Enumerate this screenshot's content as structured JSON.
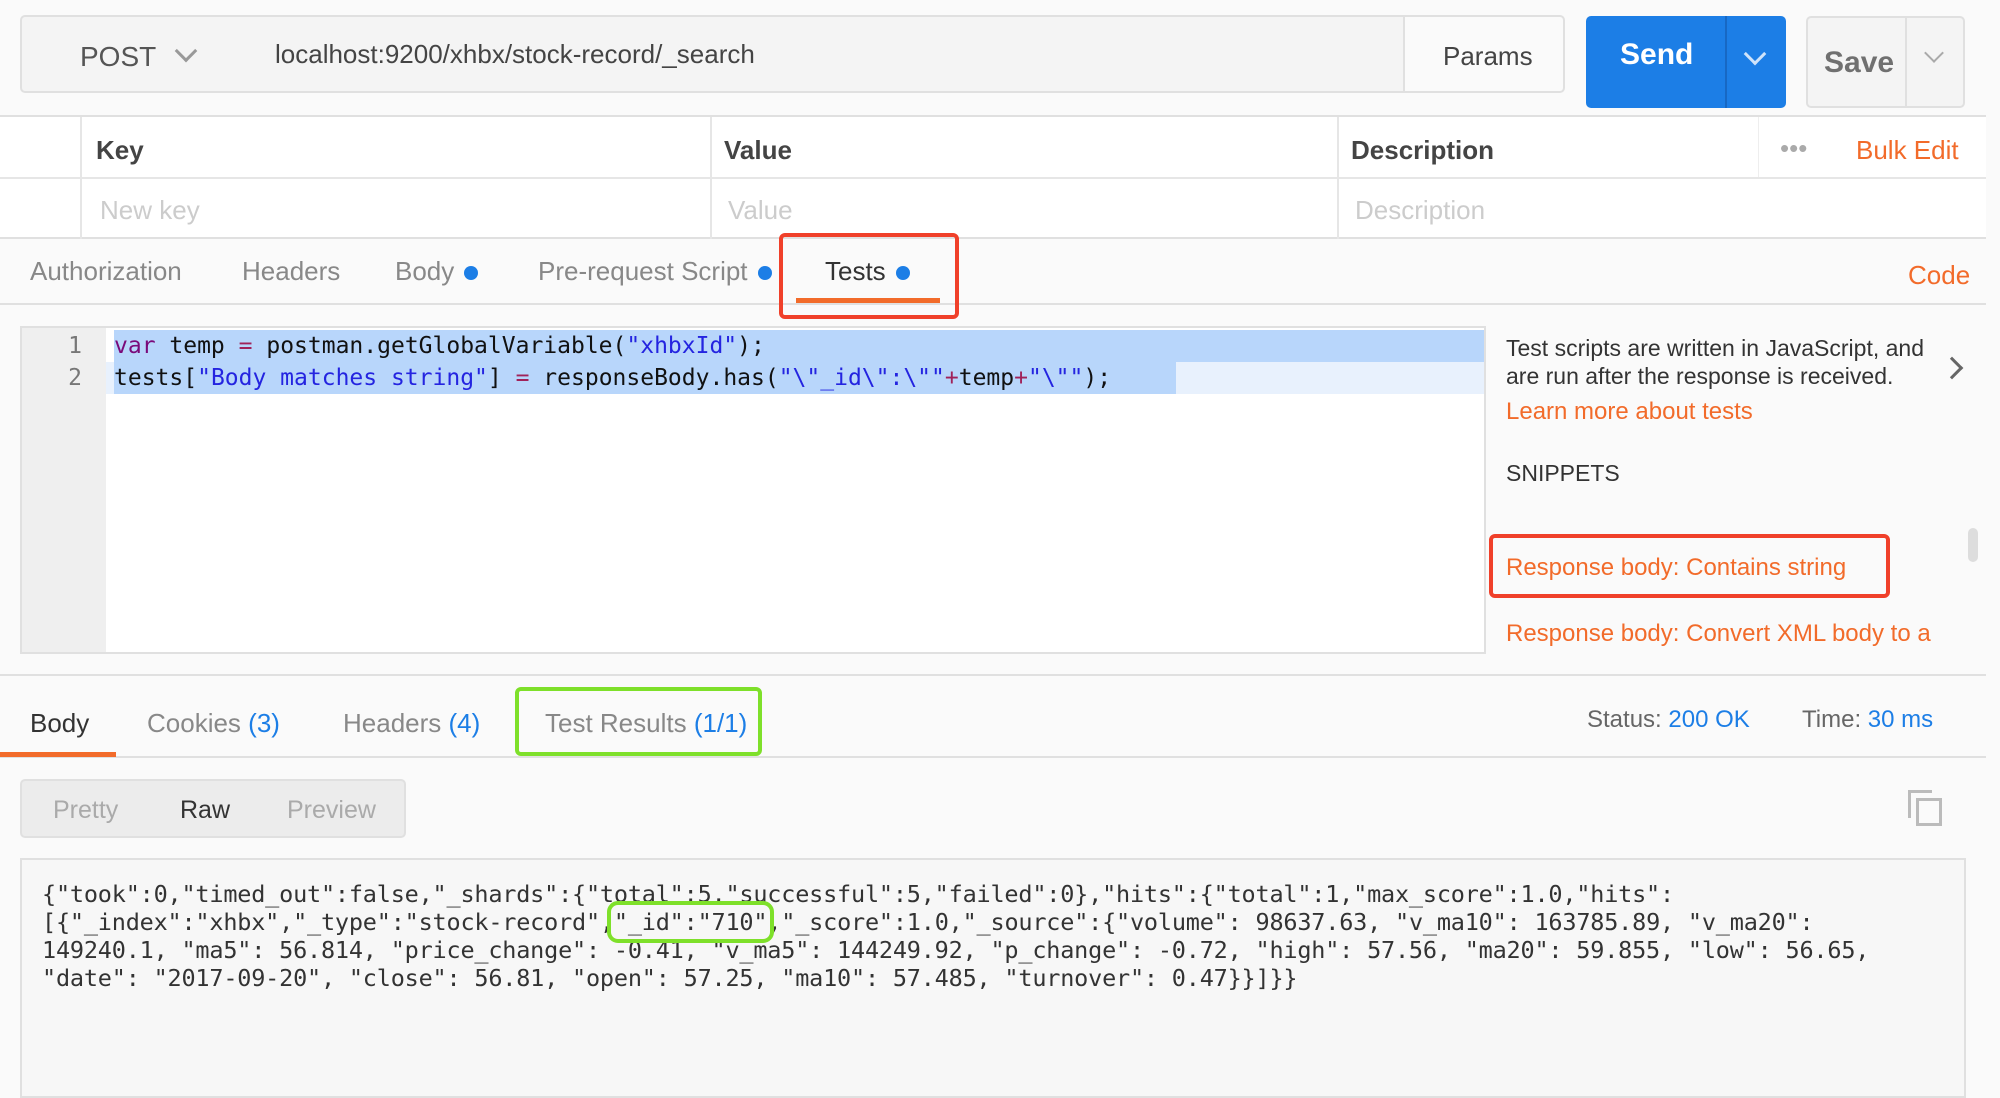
{
  "request": {
    "method": "POST",
    "url": "localhost:9200/xhbx/stock-record/_search",
    "params_label": "Params",
    "send_label": "Send",
    "save_label": "Save"
  },
  "params_table": {
    "headers": [
      "Key",
      "Value",
      "Description"
    ],
    "more_label": "•••",
    "bulk_edit_label": "Bulk Edit",
    "placeholders": {
      "key": "New key",
      "value": "Value",
      "description": "Description"
    }
  },
  "request_tabs": {
    "items": [
      {
        "label": "Authorization",
        "dot": false
      },
      {
        "label": "Headers",
        "dot": false
      },
      {
        "label": "Body",
        "dot": true
      },
      {
        "label": "Pre-request Script",
        "dot": true
      },
      {
        "label": "Tests",
        "dot": true,
        "active": true
      }
    ],
    "code_label": "Code"
  },
  "editor": {
    "line_numbers": [
      "1",
      "2"
    ],
    "lines": [
      [
        {
          "t": "var",
          "c": "kw"
        },
        {
          "t": " temp ",
          "c": "p"
        },
        {
          "t": "=",
          "c": "op"
        },
        {
          "t": " postman.getGlobalVariable(",
          "c": "p"
        },
        {
          "t": "\"xhbxId\"",
          "c": "s"
        },
        {
          "t": ");",
          "c": "p"
        }
      ],
      [
        {
          "t": "tests[",
          "c": "p"
        },
        {
          "t": "\"Body matches string\"",
          "c": "s"
        },
        {
          "t": "] ",
          "c": "p"
        },
        {
          "t": "=",
          "c": "op"
        },
        {
          "t": " responseBody.has(",
          "c": "p"
        },
        {
          "t": "\"\\\"_id\\\":\\\"\"",
          "c": "s"
        },
        {
          "t": "+",
          "c": "op"
        },
        {
          "t": "temp",
          "c": "p"
        },
        {
          "t": "+",
          "c": "op"
        },
        {
          "t": "\"\\\"\"",
          "c": "s"
        },
        {
          "t": ");",
          "c": "p"
        }
      ]
    ]
  },
  "side_panel": {
    "description": "Test scripts are written in JavaScript, and are run after the response is received.",
    "learn_more": "Learn more about tests",
    "snippets_title": "SNIPPETS",
    "snippets": [
      "Response body: Contains string",
      "Response body: Convert XML body to a"
    ]
  },
  "response_tabs": {
    "items": [
      {
        "label": "Body",
        "count": ""
      },
      {
        "label": "Cookies",
        "count": "(3)"
      },
      {
        "label": "Headers",
        "count": "(4)"
      },
      {
        "label": "Test Results",
        "count": "(1/1)"
      }
    ],
    "status_label": "Status:",
    "status_value": "200 OK",
    "time_label": "Time:",
    "time_value": "30 ms"
  },
  "view_modes": [
    "Pretty",
    "Raw",
    "Preview"
  ],
  "response_body": {
    "lines": [
      [
        "{\"took\":0,\"timed_out\":false,\"_shards\":{\"total\":5,\"successful\":5,\"failed\":0},\"hits\":{\"total\":1,\"max_score\":1.0,\"hits\":"
      ],
      [
        "[{\"_index\":\"xhbx\",\"_type\":\"stock-record\",",
        "\"_id\":\"710\"",
        ",\"_score\":1.0,\"_source\":{\"volume\": 98637.63, \"v_ma10\": 163785.89, \"v_ma20\":"
      ],
      [
        "149240.1, \"ma5\": 56.814, \"price_change\": -0.41, \"v_ma5\": 144249.92, \"p_change\": -0.72, \"high\": 57.56, \"ma20\": 59.855, \"low\": 56.65,"
      ],
      [
        "\"date\": \"2017-09-20\", \"close\": 56.81, \"open\": 57.25, \"ma10\": 57.485, \"turnover\": 0.47}}]}}"
      ]
    ]
  },
  "colors": {
    "accent_orange": "#f26b2a",
    "send_blue": "#1c7ee6",
    "highlight_red": "#f0402a",
    "highlight_green": "#7ee02a"
  }
}
